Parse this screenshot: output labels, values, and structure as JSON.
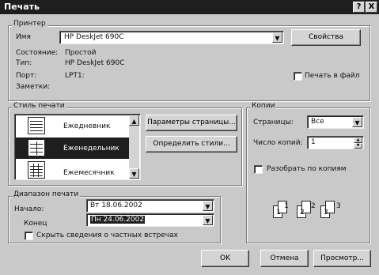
{
  "window": {
    "title": "Печать",
    "help_button": "?",
    "close_button": "X"
  },
  "printer": {
    "group_label": "Принтер",
    "name_label": "Имя",
    "name_value": "HP DeskJet 690C",
    "properties_button": "Свойства",
    "status_label": "Состояние:",
    "status_value": "Простой",
    "type_label": "Тип:",
    "type_value": "HP DeskJet 690C",
    "port_label": "Порт:",
    "port_value": "LPT1:",
    "comment_label": "Заметки:",
    "print_to_file_label": "Печать в файл"
  },
  "print_style": {
    "group_label": "Стиль печати",
    "items": [
      {
        "label": "Ежедневник",
        "icon": "daily-style-icon"
      },
      {
        "label": "Еженедельник",
        "icon": "weekly-style-icon"
      },
      {
        "label": "Ежемесячник",
        "icon": "monthly-style-icon"
      }
    ],
    "selected_index": 1,
    "page_setup_button": "Параметры страницы...",
    "define_styles_button": "Определить стили..."
  },
  "copies": {
    "group_label": "Копии",
    "pages_label": "Страницы:",
    "pages_value": "Все",
    "count_label": "Число копий:",
    "count_value": "1",
    "collate_label": "Разобрать по копиям",
    "collate_pages": [
      "1",
      "1",
      "2",
      "2",
      "3",
      "3"
    ]
  },
  "print_range": {
    "group_label": "Диапазон печати",
    "start_label": "Начало:",
    "start_value": "Вт 18.06.2002",
    "end_label": "Конец",
    "end_value": "Пн 24.06.2002",
    "hide_private_label": "Скрыть сведения о частных встречах"
  },
  "footer": {
    "ok_button": "OK",
    "cancel_button": "Отмена",
    "preview_button": "Просмотр..."
  }
}
